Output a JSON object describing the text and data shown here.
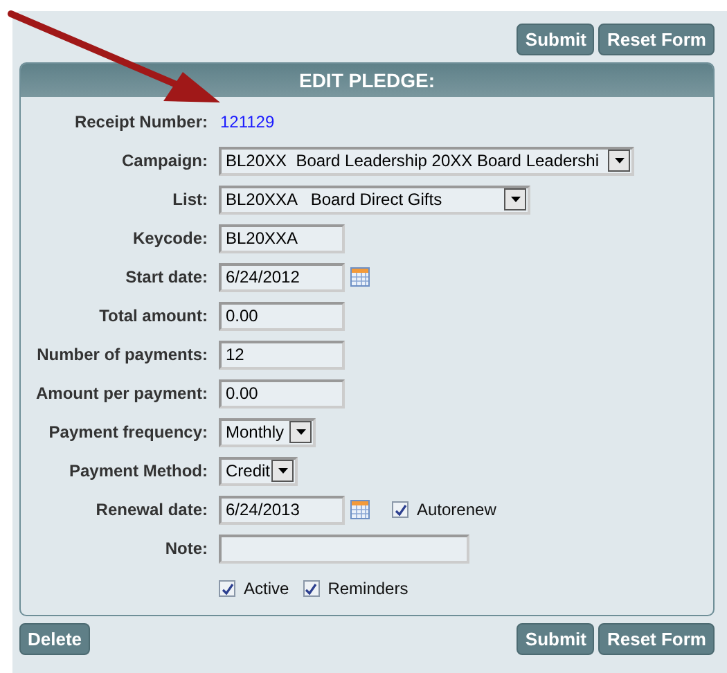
{
  "top_buttons": [
    "Submit",
    "Reset Form"
  ],
  "panel": {
    "title": "EDIT PLEDGE:"
  },
  "fields": [
    {
      "kind": "link",
      "label": "Receipt Number:",
      "value": "121129"
    },
    {
      "kind": "select",
      "label": "Campaign:",
      "value": "BL20XX  Board Leadership 20XX Board Leadershi"
    },
    {
      "kind": "select",
      "label": "List:",
      "value": "BL20XXA   Board Direct Gifts"
    },
    {
      "kind": "text",
      "label": "Keycode:",
      "value": "BL20XXA"
    },
    {
      "kind": "date",
      "label": "Start date:",
      "value": "6/24/2012"
    },
    {
      "kind": "text",
      "label": "Total amount:",
      "value": "0.00"
    },
    {
      "kind": "text",
      "label": "Number of payments:",
      "value": "12"
    },
    {
      "kind": "text",
      "label": "Amount per payment:",
      "value": "0.00"
    },
    {
      "kind": "select",
      "label": "Payment frequency:",
      "value": "Monthly"
    },
    {
      "kind": "select",
      "label": "Payment Method:",
      "value": "Credit"
    },
    {
      "kind": "date",
      "label": "Renewal date:",
      "value": "6/24/2013",
      "checkbox": {
        "label": "Autorenew",
        "checked": true
      }
    },
    {
      "kind": "note",
      "label": "Note:"
    },
    {
      "kind": "checks",
      "items": [
        {
          "label": "Active",
          "checked": true
        },
        {
          "label": "Reminders",
          "checked": true
        }
      ]
    }
  ],
  "bottom_left_buttons": [
    "Delete"
  ],
  "bottom_right_buttons": [
    "Submit",
    "Reset Form"
  ]
}
